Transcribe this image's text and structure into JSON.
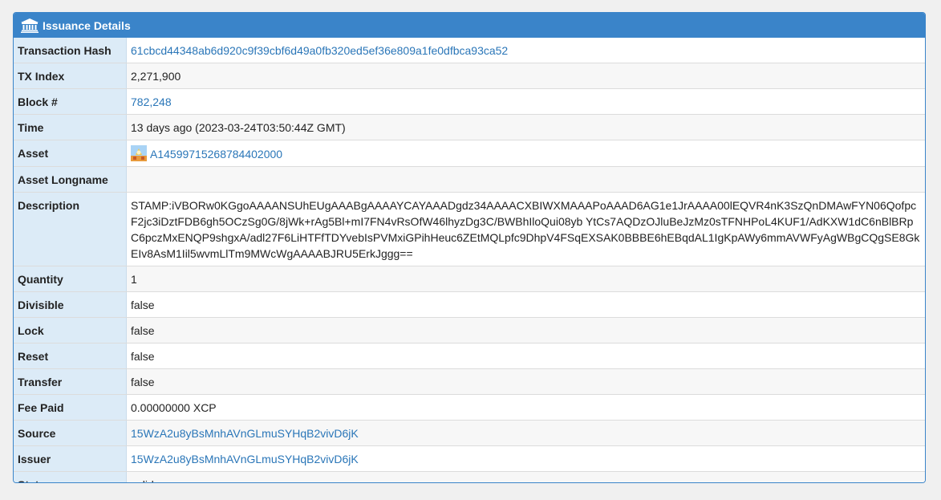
{
  "panel": {
    "title": "Issuance Details",
    "icon": "bank-icon",
    "accent": "#3a84c9"
  },
  "rows": {
    "tx_hash": {
      "label": "Transaction Hash",
      "value": "61cbcd44348ab6d920c9f39cbf6d49a0fb320ed5ef36e809a1fe0dfbca93ca52"
    },
    "tx_index": {
      "label": "TX Index",
      "value": "2,271,900"
    },
    "block": {
      "label": "Block #",
      "value": "782,248"
    },
    "time": {
      "label": "Time",
      "value": "13 days ago (2023-03-24T03:50:44Z GMT)"
    },
    "asset": {
      "label": "Asset",
      "value": "A14599715268784402000",
      "icon": "asset-stamp-icon"
    },
    "asset_longname": {
      "label": "Asset Longname",
      "value": ""
    },
    "description": {
      "label": "Description",
      "value": "STAMP:iVBORw0KGgoAAAANSUhEUgAAABgAAAAYCAYAAADgdz34AAAACXBIWXMAAAPoAAAD6AG1e1JrAAAA00lEQVR4nK3SzQnDMAwFYN06QofpcF2jc3iDztFDB6gh5OCzSg0G/8jWk+rAg5Bl+mI7FN4vRsOfW46lhyzDg3C/BWBhIloQui08yb YtCs7AQDzOJluBeJzMz0sTFNHPoL4KUF1/AdKXW1dC6nBlBRpC6pczMxENQP9shgxA/adl27F6LiHTFfTDYvebIsPVMxiGPihHeuc6ZEtMQLpfc9DhpV4FSqEXSAK0BBBE6hEBqdAL1IgKpAWy6mmAVWFyAgWBgCQgSE8GkEIv8AsM1Iil5wvmLlTm9MWcWgAAAABJRU5ErkJggg=="
    },
    "quantity": {
      "label": "Quantity",
      "value": "1"
    },
    "divisible": {
      "label": "Divisible",
      "value": "false"
    },
    "lock": {
      "label": "Lock",
      "value": "false"
    },
    "reset": {
      "label": "Reset",
      "value": "false"
    },
    "transfer": {
      "label": "Transfer",
      "value": "false"
    },
    "fee_paid": {
      "label": "Fee Paid",
      "value": "0.00000000 XCP"
    },
    "source": {
      "label": "Source",
      "value": "15WzA2u8yBsMnhAVnGLmuSYHqB2vivD6jK"
    },
    "issuer": {
      "label": "Issuer",
      "value": "15WzA2u8yBsMnhAVnGLmuSYHqB2vivD6jK"
    },
    "status": {
      "label": "Status",
      "value": "valid"
    }
  }
}
